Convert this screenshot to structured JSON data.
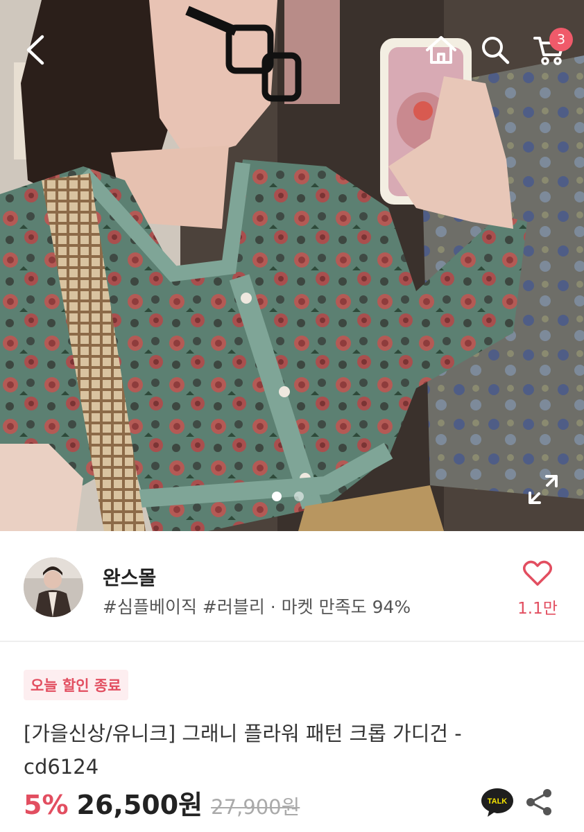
{
  "header": {
    "back_icon": "chevron-left-icon",
    "home_icon": "home-icon",
    "search_icon": "search-icon",
    "cart_icon": "cart-icon",
    "cart_count": "3"
  },
  "gallery": {
    "total_images": 2,
    "active_index": 0,
    "expand_icon": "expand-icon"
  },
  "shop": {
    "name": "완스몰",
    "tags": "#심플베이직 #러블리 · 마켓 만족도 94%",
    "like_count": "1.1만",
    "like_icon": "heart-outline-icon"
  },
  "product": {
    "badge": "오늘 할인 종료",
    "title": "[가을신상/유니크] 그래니 플라워 패턴 크롭 가디건 - cd6124",
    "discount": "5%",
    "price": "26,500원",
    "original_price": "27,900원",
    "talk_label": "TALK",
    "share_icon": "share-icon"
  },
  "colors": {
    "accent": "#e24e60",
    "badge_bg": "#fdeef0",
    "cart_badge": "#f05a6a"
  }
}
